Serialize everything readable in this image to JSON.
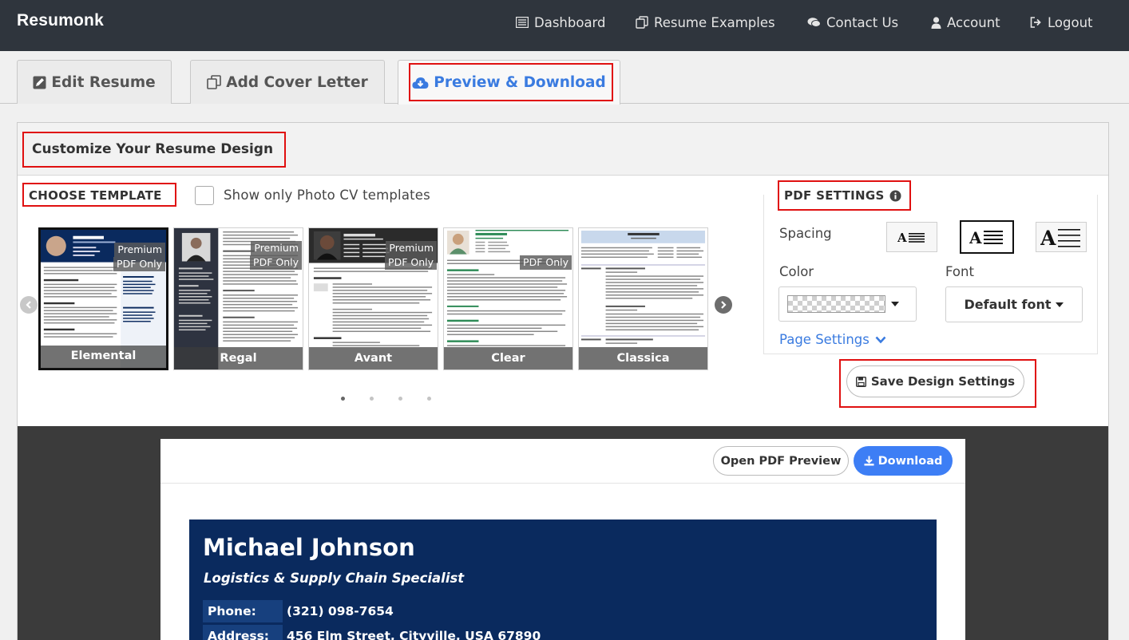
{
  "navbar": {
    "brand": "Resumonk",
    "items": [
      {
        "label": "Dashboard",
        "icon": "dashboard-icon"
      },
      {
        "label": "Resume Examples",
        "icon": "copy-icon"
      },
      {
        "label": "Contact Us",
        "icon": "chat-icon"
      },
      {
        "label": "Account",
        "icon": "user-icon"
      },
      {
        "label": "Logout",
        "icon": "logout-icon"
      }
    ]
  },
  "tabs": [
    {
      "label": "Edit Resume",
      "icon": "edit-icon",
      "active": false
    },
    {
      "label": "Add Cover Letter",
      "icon": "copy-icon",
      "active": false
    },
    {
      "label": "Preview & Download",
      "icon": "cloud-download-icon",
      "active": true
    }
  ],
  "customize": {
    "title": "Customize Your Resume Design",
    "choose_template_label": "CHOOSE TEMPLATE",
    "photo_filter_label": "Show only Photo CV templates",
    "photo_filter_checked": false
  },
  "templates": [
    {
      "name": "Elemental",
      "badge1": "Premium",
      "badge2": "PDF Only",
      "selected": true
    },
    {
      "name": "Regal",
      "badge1": "Premium",
      "badge2": "PDF Only",
      "selected": false
    },
    {
      "name": "Avant",
      "badge1": "Premium",
      "badge2": "PDF Only",
      "selected": false
    },
    {
      "name": "Clear",
      "badge1": "",
      "badge2": "PDF Only",
      "selected": false
    },
    {
      "name": "Classica",
      "badge1": "",
      "badge2": "",
      "selected": false
    }
  ],
  "carousel": {
    "pages": 4,
    "current_page": 1
  },
  "pdf_settings": {
    "title": "PDF SETTINGS",
    "spacing_label": "Spacing",
    "spacing_options": [
      "compact",
      "normal",
      "relaxed"
    ],
    "spacing_selected": "normal",
    "color_label": "Color",
    "font_label": "Font",
    "font_value": "Default font",
    "page_settings_label": "Page Settings",
    "save_label": "Save Design Settings"
  },
  "preview": {
    "open_pdf_label": "Open PDF Preview",
    "download_label": "Download",
    "name": "Michael Johnson",
    "role": "Logistics & Supply Chain Specialist",
    "details": [
      {
        "key": "Phone:",
        "value": "(321) 098-7654"
      },
      {
        "key": "Address:",
        "value": "456 Elm Street, Cityville, USA 67890"
      }
    ]
  },
  "colors": {
    "navbar_bg": "#2f353d",
    "accent": "#3a7be0",
    "download_button": "#3d7ef5",
    "resume_header": "#0a2a5e",
    "highlight_box": "#e01010"
  }
}
